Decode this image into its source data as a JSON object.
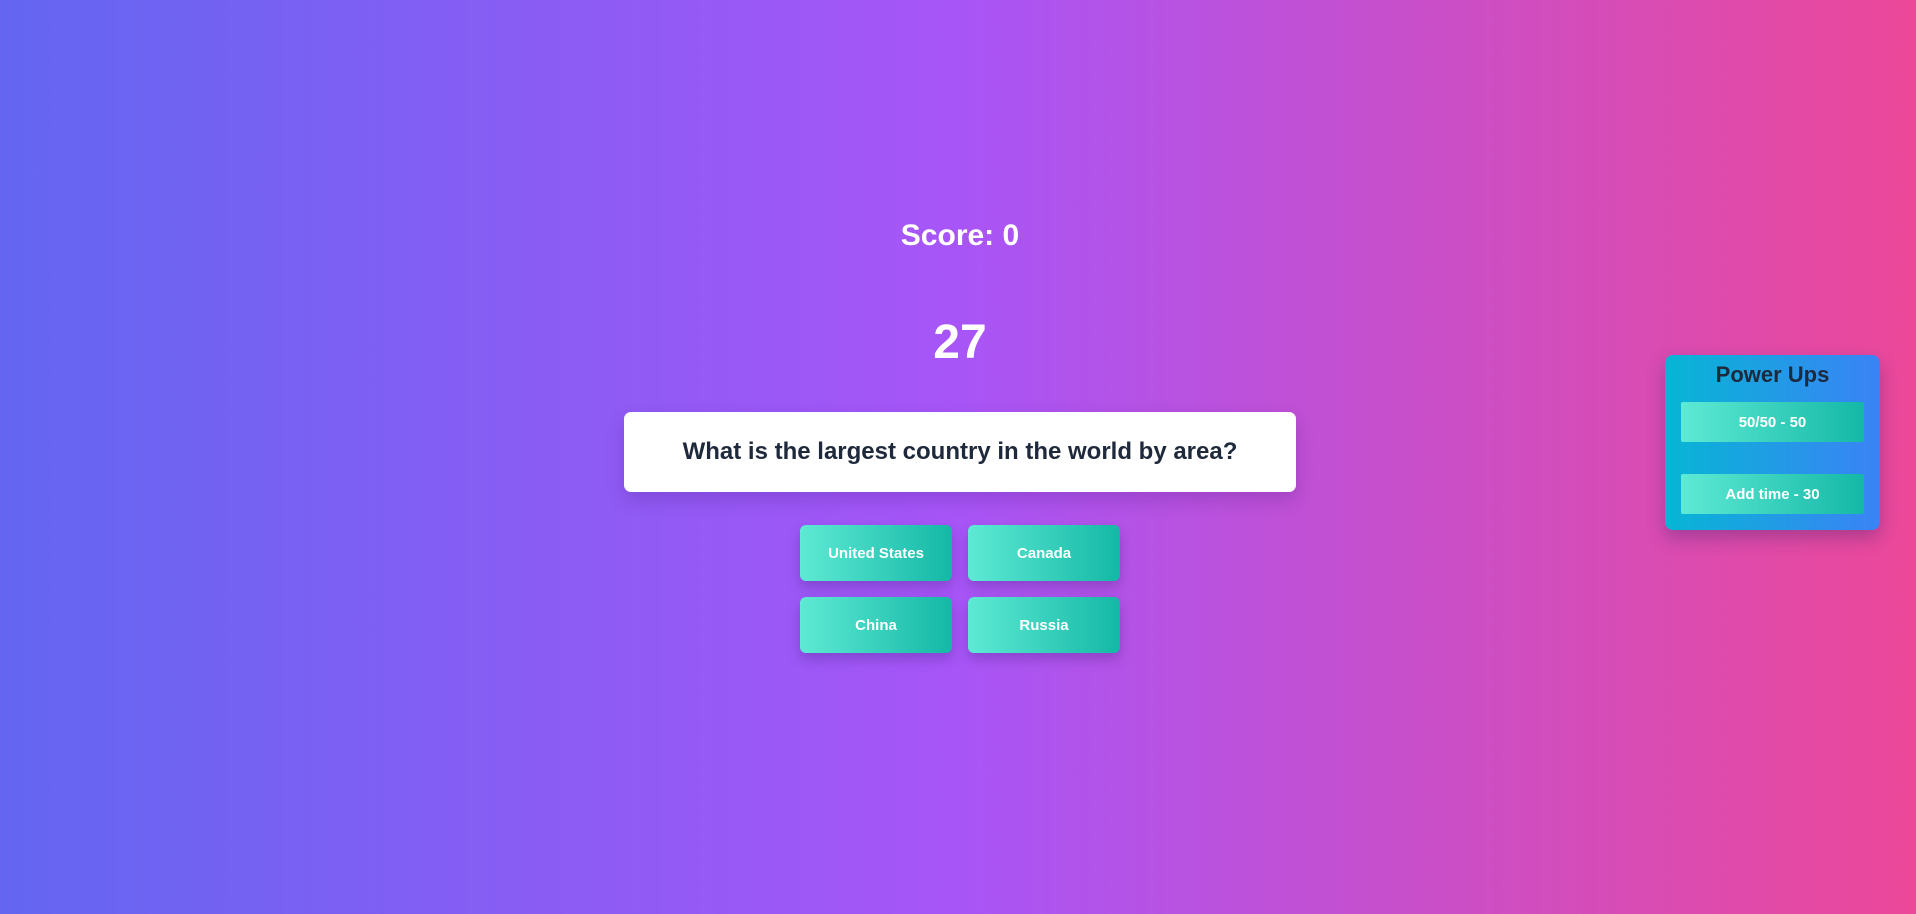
{
  "score_text": "Score: 0",
  "timer": "27",
  "question": "What is the largest country in the world by area?",
  "answers": [
    "United States",
    "Canada",
    "China",
    "Russia"
  ],
  "powerups": {
    "title": "Power Ups",
    "items": [
      {
        "label": "50/50 - 50"
      },
      {
        "label": "Add time - 30"
      }
    ]
  },
  "colors": {
    "background_gradient": [
      "#6366f1",
      "#a855f7",
      "#ec4899"
    ],
    "button_gradient": [
      "#5eead4",
      "#14b8a6"
    ],
    "panel_gradient": [
      "#06b6d4",
      "#3b82f6"
    ],
    "question_text": "#1e293b"
  }
}
